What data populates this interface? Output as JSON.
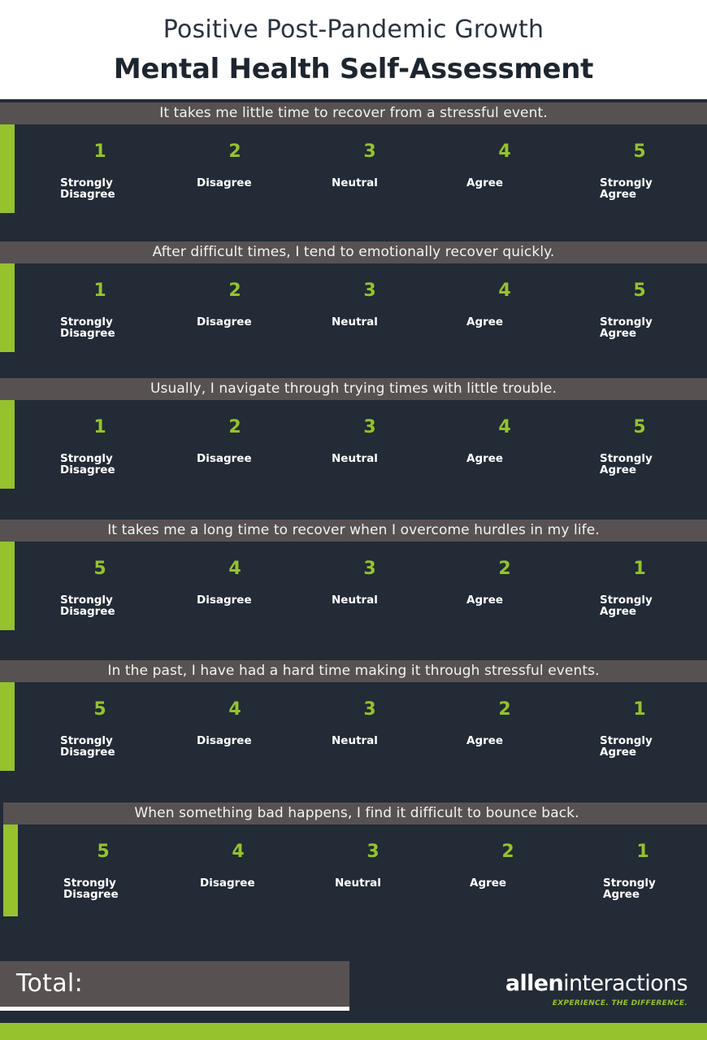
{
  "header": {
    "eyebrow": "Positive Post-Pandemic Growth",
    "title": "Mental Health Self-Assessment"
  },
  "colors": {
    "accent_green": "#95c22d",
    "dark_navy": "#222b36",
    "bar_gray": "#575251",
    "text_white": "#ffffff",
    "header_text": "#1d2630"
  },
  "questions": [
    {
      "text": "It takes me little time to recover from a stressful event.",
      "options": [
        {
          "number": "1",
          "label": "Strongly\nDisagree"
        },
        {
          "number": "2",
          "label": "Disagree"
        },
        {
          "number": "3",
          "label": "Neutral"
        },
        {
          "number": "4",
          "label": "Agree"
        },
        {
          "number": "5",
          "label": "Strongly\nAgree"
        }
      ]
    },
    {
      "text": "After difficult times, I tend to emotionally recover quickly.",
      "options": [
        {
          "number": "1",
          "label": "Strongly\nDisagree"
        },
        {
          "number": "2",
          "label": "Disagree"
        },
        {
          "number": "3",
          "label": "Neutral"
        },
        {
          "number": "4",
          "label": "Agree"
        },
        {
          "number": "5",
          "label": "Strongly\nAgree"
        }
      ]
    },
    {
      "text": "Usually, I navigate through trying times with little trouble.",
      "options": [
        {
          "number": "1",
          "label": "Strongly\nDisagree"
        },
        {
          "number": "2",
          "label": "Disagree"
        },
        {
          "number": "3",
          "label": "Neutral"
        },
        {
          "number": "4",
          "label": "Agree"
        },
        {
          "number": "5",
          "label": "Strongly\nAgree"
        }
      ]
    },
    {
      "text": "It takes me a long time to recover when I overcome hurdles in my life.",
      "options": [
        {
          "number": "5",
          "label": "Strongly\nDisagree"
        },
        {
          "number": "4",
          "label": "Disagree"
        },
        {
          "number": "3",
          "label": "Neutral"
        },
        {
          "number": "2",
          "label": "Agree"
        },
        {
          "number": "1",
          "label": "Strongly\nAgree"
        }
      ]
    },
    {
      "text": "In the past, I have had a hard time making it through stressful events.",
      "options": [
        {
          "number": "5",
          "label": "Strongly\nDisagree"
        },
        {
          "number": "4",
          "label": "Disagree"
        },
        {
          "number": "3",
          "label": "Neutral"
        },
        {
          "number": "2",
          "label": "Agree"
        },
        {
          "number": "1",
          "label": "Strongly\nAgree"
        }
      ]
    },
    {
      "text": "When something bad happens, I find it difficult to bounce back.",
      "options": [
        {
          "number": "5",
          "label": "Strongly\nDisagree"
        },
        {
          "number": "4",
          "label": "Disagree"
        },
        {
          "number": "3",
          "label": "Neutral"
        },
        {
          "number": "2",
          "label": "Agree"
        },
        {
          "number": "1",
          "label": "Strongly\nAgree"
        }
      ]
    }
  ],
  "total": {
    "label": "Total:"
  },
  "logo": {
    "bold_part": "allen",
    "light_part": "interactions",
    "tagline": "EXPERIENCE. THE DIFFERENCE."
  }
}
